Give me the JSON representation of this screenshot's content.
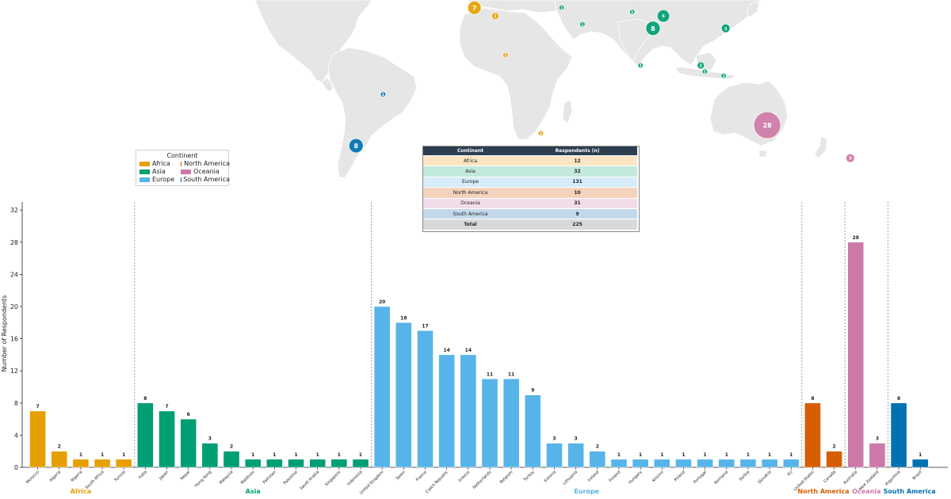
{
  "legend": {
    "title": "Continent",
    "items": [
      {
        "label": "Africa",
        "color": "#E69F00"
      },
      {
        "label": "North America",
        "color": "#D55E00"
      },
      {
        "label": "Asia",
        "color": "#009E73"
      },
      {
        "label": "Oceania",
        "color": "#CC79A7"
      },
      {
        "label": "Europe",
        "color": "#56B4E9"
      },
      {
        "label": "South America",
        "color": "#0072B2"
      }
    ]
  },
  "summary_table": {
    "headers": [
      "Continent",
      "Respondents (n)"
    ],
    "rows": [
      {
        "continent": "Africa",
        "n": "12",
        "bg": "#fbe5c3"
      },
      {
        "continent": "Asia",
        "n": "32",
        "bg": "#c3e8dd"
      },
      {
        "continent": "Europe",
        "n": "131",
        "bg": "#d6ecf9"
      },
      {
        "continent": "North America",
        "n": "10",
        "bg": "#f4d3bd"
      },
      {
        "continent": "Oceania",
        "n": "31",
        "bg": "#f1dcea"
      },
      {
        "continent": "South America",
        "n": "9",
        "bg": "#c3d9eb"
      }
    ],
    "total": {
      "label": "Total",
      "n": "225"
    }
  },
  "map_markers": [
    {
      "label": "7",
      "continent": "Africa",
      "lon": -7,
      "lat": 32
    },
    {
      "label": "2",
      "continent": "Africa",
      "lon": 3,
      "lat": 28
    },
    {
      "label": "1",
      "continent": "Africa",
      "lon": 8,
      "lat": 9
    },
    {
      "label": "1",
      "continent": "Africa",
      "lon": 25,
      "lat": -29
    },
    {
      "label": "8",
      "continent": "Asia",
      "lon": 79,
      "lat": 22
    },
    {
      "label": "6",
      "continent": "Asia",
      "lon": 84,
      "lat": 28
    },
    {
      "label": "3",
      "continent": "Asia",
      "lon": 114,
      "lat": 22
    },
    {
      "label": "1",
      "continent": "Asia",
      "lon": 73,
      "lat": 4
    },
    {
      "label": "1",
      "continent": "Asia",
      "lon": 69,
      "lat": 30
    },
    {
      "label": "1",
      "continent": "Asia",
      "lon": 35,
      "lat": 32
    },
    {
      "label": "1",
      "continent": "Asia",
      "lon": 45,
      "lat": 24
    },
    {
      "label": "1",
      "continent": "Asia",
      "lon": 104,
      "lat": 1
    },
    {
      "label": "2",
      "continent": "Asia",
      "lon": 102,
      "lat": 4
    },
    {
      "label": "1",
      "continent": "Asia",
      "lon": 113,
      "lat": -1
    },
    {
      "label": "28",
      "continent": "Oceania",
      "lon": 134,
      "lat": -25
    },
    {
      "label": "3",
      "continent": "Oceania",
      "lon": 174,
      "lat": -41
    },
    {
      "label": "8",
      "continent": "South America",
      "lon": -64,
      "lat": -35
    },
    {
      "label": "1",
      "continent": "South America",
      "lon": -51,
      "lat": -10
    }
  ],
  "chart_data": {
    "type": "bar",
    "xlabel": "",
    "ylabel": "Number of Respondents",
    "ylim": [
      0,
      33
    ],
    "yticks": [
      0,
      4,
      8,
      12,
      16,
      20,
      24,
      28,
      32
    ],
    "grid": false,
    "groups": [
      {
        "name": "Africa",
        "color": "#E69F00",
        "categories": [
          "Morocco",
          "Algeria",
          "Nigeria",
          "South Africa",
          "Tunisia"
        ],
        "values": [
          7,
          2,
          1,
          1,
          1
        ]
      },
      {
        "name": "Asia",
        "color": "#009E73",
        "categories": [
          "India",
          "Japan",
          "Nepal",
          "Hong Kong",
          "Malaysia",
          "Maldives",
          "Pakistan",
          "Palestine",
          "Saudi Arabia",
          "Singapore",
          "Indonesia"
        ],
        "values": [
          8,
          7,
          6,
          3,
          2,
          1,
          1,
          1,
          1,
          1,
          1
        ]
      },
      {
        "name": "Europe",
        "color": "#56B4E9",
        "categories": [
          "United Kingdom",
          "Spain",
          "France",
          "Czech Republic",
          "Greece",
          "Netherlands",
          "Belgium",
          "Turkey",
          "Estonia",
          "Lithuania",
          "Ireland",
          "Finland",
          "Hungary",
          "Kosovo",
          "Poland",
          "Portugal",
          "Romania",
          "Serbia",
          "Slovakia",
          "EU"
        ],
        "values": [
          20,
          18,
          17,
          14,
          14,
          11,
          11,
          9,
          3,
          3,
          2,
          1,
          1,
          1,
          1,
          1,
          1,
          1,
          1,
          1
        ]
      },
      {
        "name": "North America",
        "color": "#D55E00",
        "categories": [
          "United States",
          "Canada"
        ],
        "values": [
          8,
          2
        ]
      },
      {
        "name": "Oceania",
        "color": "#CC79A7",
        "categories": [
          "Australia",
          "New Zealand"
        ],
        "values": [
          28,
          3
        ]
      },
      {
        "name": "South America",
        "color": "#0072B2",
        "categories": [
          "Argentina",
          "Brazil"
        ],
        "values": [
          8,
          1
        ]
      }
    ]
  }
}
